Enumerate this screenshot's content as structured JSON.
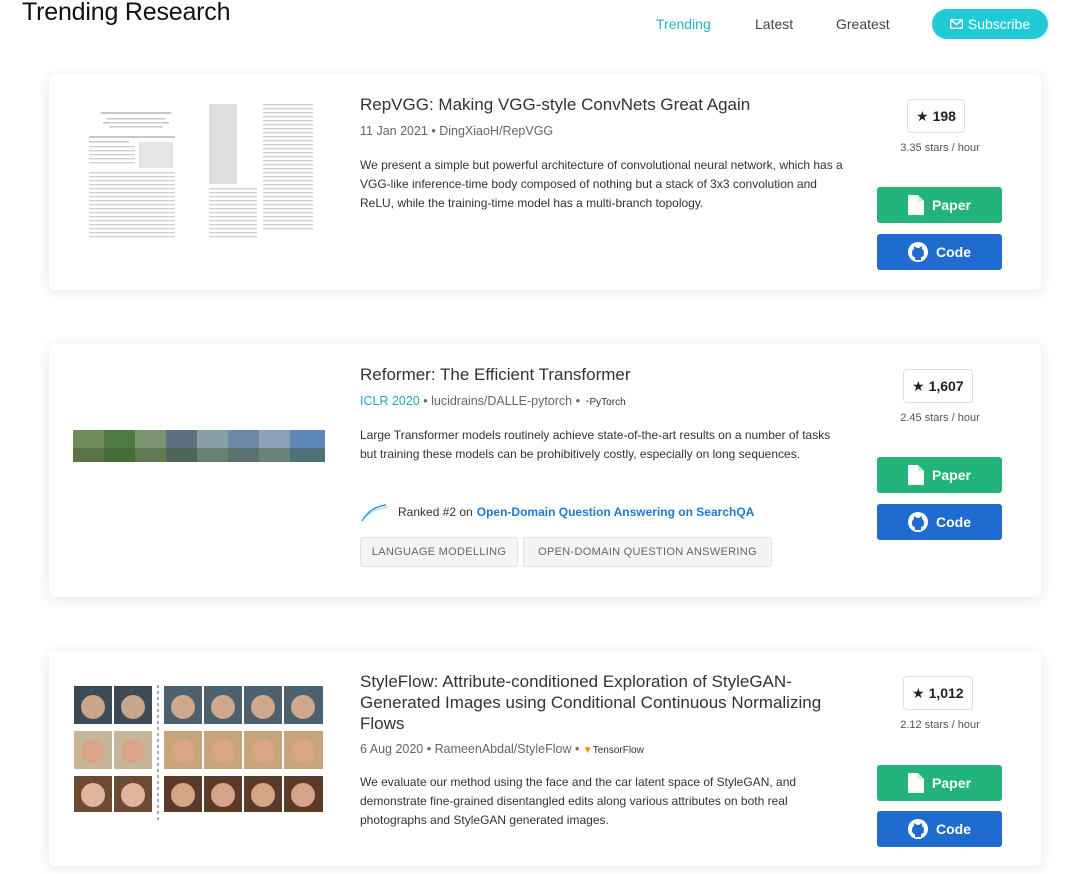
{
  "header": {
    "title": "Trending Research",
    "nav": [
      {
        "label": "Trending",
        "active": true
      },
      {
        "label": "Latest",
        "active": false
      },
      {
        "label": "Greatest",
        "active": false
      }
    ],
    "subscribe_label": "Subscribe",
    "subscribe_icon": "envelope-icon"
  },
  "colors": {
    "accent": "#21cbd6",
    "paper_button": "#21b37a",
    "code_button": "#1f6bd0",
    "link": "#1f7acf"
  },
  "papers": [
    {
      "title": "RepVGG: Making VGG-style ConvNets Great Again",
      "date": "11 Jan 2021",
      "repo": "DingXiaoH/RepVGG",
      "abstract": "We present a simple but powerful architecture of convolutional neural network, which has a VGG-like inference-time body composed of nothing but a stack of 3x3 convolution and ReLU, while the training-time model has a multi-branch topology.",
      "stars": "198",
      "rate": "3.35 stars / hour",
      "paper_label": "Paper",
      "code_label": "Code"
    },
    {
      "title": "Reformer: The Efficient Transformer",
      "conference": "ICLR 2020",
      "repo": "lucidrains/DALLE-pytorch",
      "framework": "PyTorch",
      "abstract": "Large Transformer models routinely achieve state-of-the-art results on a number of tasks but training these models can be prohibitively costly, especially on long sequences.",
      "ranked_prefix": "Ranked #2 on",
      "ranked_task": "Open-Domain Question Answering on SearchQA",
      "tags": [
        "LANGUAGE MODELLING",
        "OPEN-DOMAIN QUESTION ANSWERING"
      ],
      "stars": "1,607",
      "rate": "2.45 stars / hour",
      "paper_label": "Paper",
      "code_label": "Code"
    },
    {
      "title": "StyleFlow: Attribute-conditioned Exploration of StyleGAN-Generated Images using Conditional Continuous Normalizing Flows",
      "date": "6 Aug 2020",
      "repo": "RameenAbdal/StyleFlow",
      "framework": "TensorFlow",
      "abstract": "We evaluate our method using the face and the car latent space of StyleGAN, and demonstrate fine-grained disentangled edits along various attributes on both real photographs and StyleGAN generated images.",
      "stars": "1,012",
      "rate": "2.12 stars / hour",
      "paper_label": "Paper",
      "code_label": "Code"
    }
  ]
}
